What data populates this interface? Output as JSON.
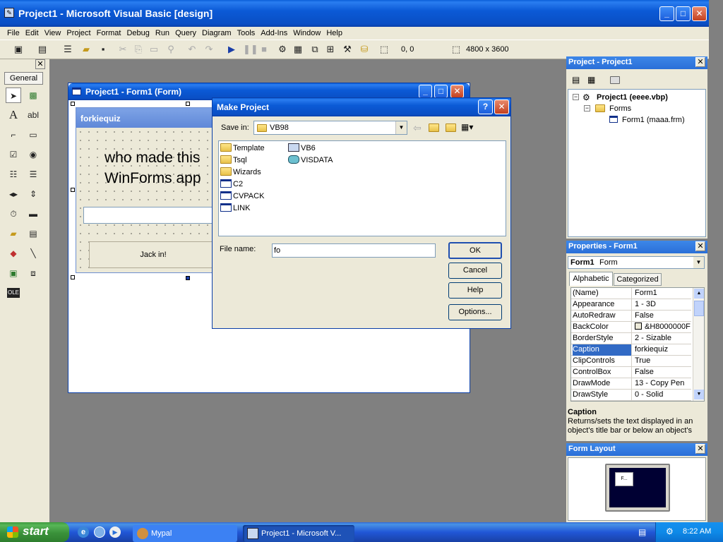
{
  "window": {
    "title": "Project1 - Microsoft Visual Basic [design]"
  },
  "menu": [
    "File",
    "Edit",
    "View",
    "Project",
    "Format",
    "Debug",
    "Run",
    "Query",
    "Diagram",
    "Tools",
    "Add-Ins",
    "Window",
    "Help"
  ],
  "toolbar": {
    "position": "0, 0",
    "size": "4800 x 3600"
  },
  "toolbox": {
    "tab": "General"
  },
  "form_designer": {
    "title": "Project1 - Form1 (Form)",
    "form_caption": "forkiequiz",
    "label_line1": "who made this",
    "label_line2": "WinForms app",
    "button_label": "Jack in!"
  },
  "dialog": {
    "title": "Make Project",
    "help_glyph": "?",
    "save_in_label": "Save in:",
    "save_in_value": "VB98",
    "files_col1": [
      "Template",
      "Tsql",
      "Wizards",
      "C2",
      "CVPACK",
      "LINK"
    ],
    "files_col2": [
      "VB6",
      "VISDATA"
    ],
    "file_name_label": "File name:",
    "file_name_value": "fo",
    "ok": "OK",
    "cancel": "Cancel",
    "help": "Help",
    "options": "Options..."
  },
  "project_panel": {
    "title": "Project - Project1",
    "root": "Project1 (eeee.vbp)",
    "folder": "Forms",
    "form": "Form1 (maaa.frm)"
  },
  "properties_panel": {
    "title": "Properties - Form1",
    "object_name": "Form1",
    "object_type": "Form",
    "tab_alpha": "Alphabetic",
    "tab_cat": "Categorized",
    "rows": [
      {
        "name": "(Name)",
        "value": "Form1"
      },
      {
        "name": "Appearance",
        "value": "1 - 3D"
      },
      {
        "name": "AutoRedraw",
        "value": "False"
      },
      {
        "name": "BackColor",
        "value": "&H8000000F"
      },
      {
        "name": "BorderStyle",
        "value": "2 - Sizable"
      },
      {
        "name": "Caption",
        "value": "forkiequiz"
      },
      {
        "name": "ClipControls",
        "value": "True"
      },
      {
        "name": "ControlBox",
        "value": "False"
      },
      {
        "name": "DrawMode",
        "value": "13 - Copy Pen"
      },
      {
        "name": "DrawStyle",
        "value": "0 - Solid"
      }
    ],
    "desc_title": "Caption",
    "desc_text": "Returns/sets the text displayed in an object's title bar or below an object's"
  },
  "form_layout": {
    "title": "Form Layout",
    "mini_caption": "F..."
  },
  "taskbar": {
    "start": "start",
    "task1": "Mypal",
    "task2": "Project1 - Microsoft V...",
    "clock": "8:22 AM"
  },
  "colors": {
    "accent": "#0a5fd8",
    "face": "#ece9d8",
    "selection": "#316ac5"
  }
}
